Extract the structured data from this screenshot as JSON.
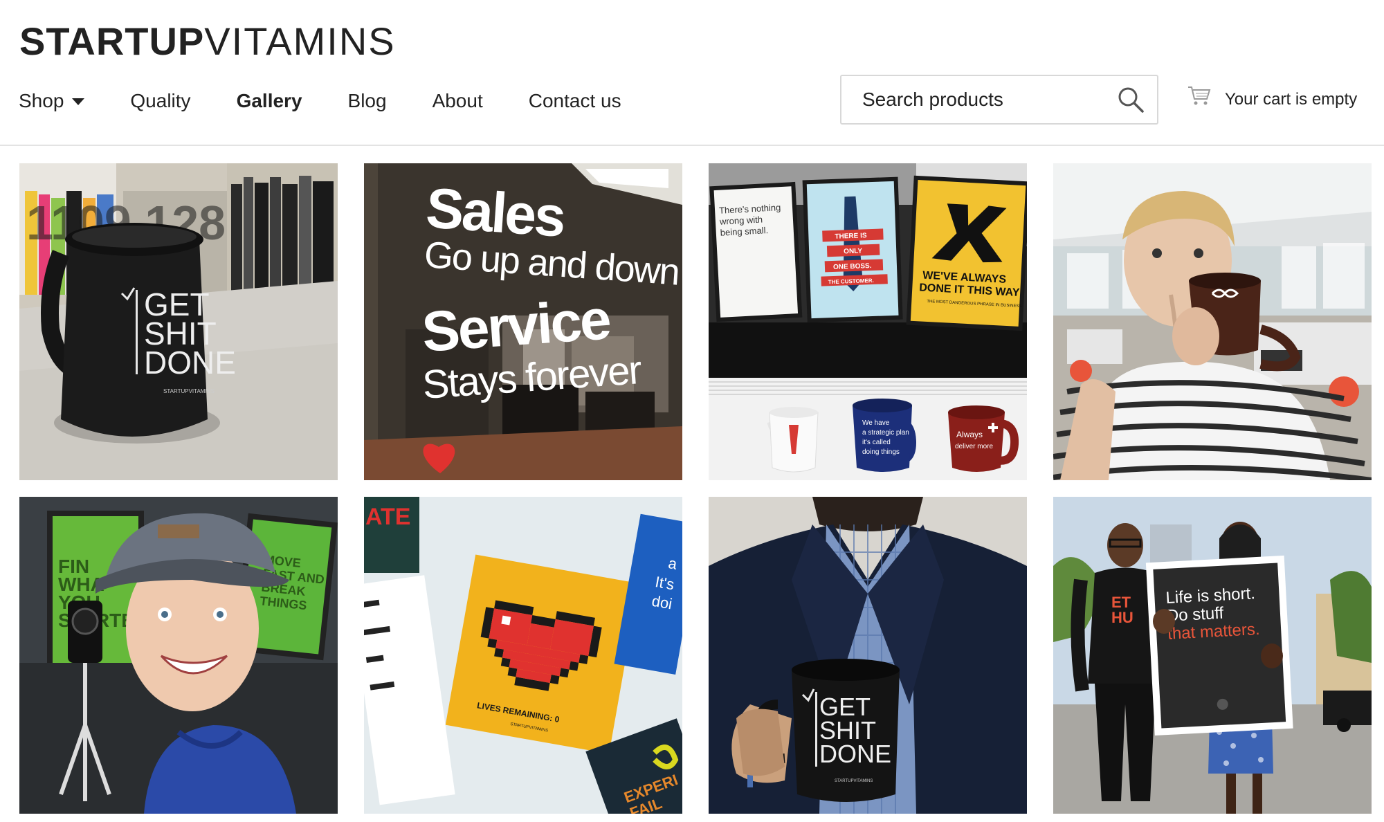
{
  "brand": {
    "logo_bold": "STARTUP",
    "logo_light": "VITAMINS"
  },
  "nav": {
    "items": [
      {
        "label": "Shop",
        "has_dropdown": true
      },
      {
        "label": "Quality"
      },
      {
        "label": "Gallery",
        "active": true
      },
      {
        "label": "Blog"
      },
      {
        "label": "About"
      },
      {
        "label": "Contact us"
      }
    ]
  },
  "search": {
    "placeholder": "Search products",
    "icon": "search-icon"
  },
  "cart": {
    "label": "Your cart is empty",
    "icon": "shopping-cart-icon"
  },
  "gallery": {
    "photos": [
      {
        "mug_text": [
          "GET",
          "SHIT",
          "DONE"
        ],
        "brand_mark": "STARTUPVITAMINS",
        "book_numbers": "1109 128"
      },
      {
        "headline1": "Sales",
        "sub1": "Go up and down",
        "headline2": "Service",
        "sub2": "Stays forever"
      },
      {
        "poster1": [
          "There's nothing",
          "wrong with",
          "being small."
        ],
        "poster2": [
          "THERE IS",
          "ONLY",
          "ONE BOSS.",
          "THE CUSTOMER."
        ],
        "poster3": [
          "WE'VE ALWAYS",
          "DONE IT THIS WAY"
        ],
        "poster3_small": "THE MOST DANGEROUS PHRASE IN BUSINESS",
        "mug_blue": [
          "We have",
          "a strategic plan",
          "it's called",
          "doing things"
        ],
        "mug_red": [
          "Always",
          "deliver more"
        ]
      },
      {},
      {
        "poster_left": [
          "FIN",
          "WHA",
          "YOU",
          "STARTE"
        ],
        "poster_right": [
          "MOVE",
          "FAST AND",
          "BREAK",
          "THINGS"
        ]
      },
      {
        "corner_text": "ATE",
        "poster_caption": "LIVES REMAINING: 0",
        "small_brand": "STARTUPVITAMINS",
        "side_text": [
          "a",
          "It's",
          "doi"
        ],
        "bottom_text": [
          "EXPERI",
          "FAIL"
        ]
      },
      {
        "mug_text": [
          "GET",
          "SHIT",
          "DONE"
        ],
        "brand_mark": "STARTUPVITAMINS"
      },
      {
        "poster_text": [
          "Life is short.",
          "Do stuff"
        ],
        "poster_highlight": "that matters.",
        "shirt_text": [
          "ET",
          "HU"
        ]
      }
    ]
  },
  "colors": {
    "text": "#222222",
    "border": "#d8d8d8",
    "heart_red": "#e0322f",
    "poster_yellow": "#f2c230",
    "mug_blue": "#1c2f7a",
    "mug_red": "#8a1f1a"
  }
}
